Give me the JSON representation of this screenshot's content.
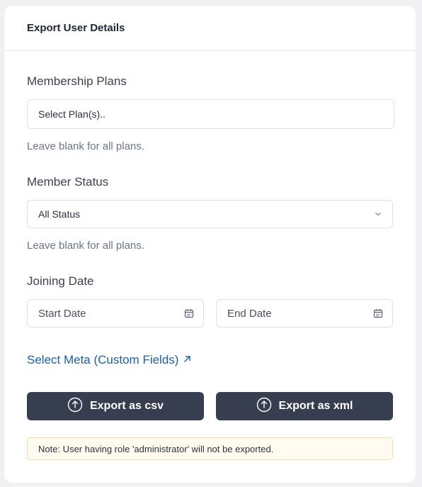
{
  "card": {
    "title": "Export User Details"
  },
  "membership": {
    "label": "Membership Plans",
    "placeholder": "Select Plan(s)..",
    "hint": "Leave blank for all plans."
  },
  "status": {
    "label": "Member Status",
    "selected": "All Status",
    "hint": "Leave blank for all plans."
  },
  "joining": {
    "label": "Joining Date",
    "start_placeholder": "Start Date",
    "end_placeholder": "End Date"
  },
  "meta_link": {
    "label": "Select Meta (Custom Fields)",
    "icon": "external-arrow-icon"
  },
  "buttons": {
    "csv_label": "Export as csv",
    "xml_label": "Export as xml",
    "icon": "upload-icon"
  },
  "note": "Note: User having role 'administrator' will not be exported.",
  "colors": {
    "button_bg": "#373e4f",
    "link": "#1a5fa8",
    "note_bg": "#fffcef",
    "note_border": "#f1dca3"
  }
}
